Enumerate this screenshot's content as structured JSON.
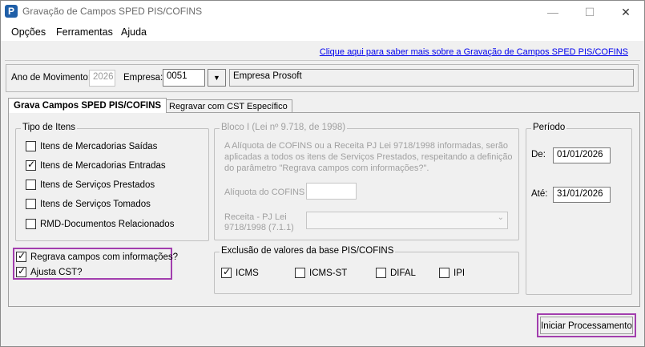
{
  "window": {
    "title": "Gravação de Campos SPED PIS/COFINS"
  },
  "menu": {
    "items": [
      "Opções",
      "Ferramentas",
      "Ajuda"
    ]
  },
  "help_link": "Clique aqui para saber mais sobre a Gravação de Campos SPED PIS/COFINS",
  "header": {
    "ano_label": "Ano de Movimento:",
    "ano_value": "2026",
    "empresa_label": "Empresa:",
    "empresa_code": "0051",
    "empresa_name": "Empresa Prosoft"
  },
  "tabs": [
    {
      "label": "Grava Campos SPED PIS/COFINS",
      "active": true
    },
    {
      "label": "Regravar com CST Específico",
      "active": false
    }
  ],
  "tipo_itens": {
    "legend": "Tipo de Itens",
    "items": [
      {
        "label": "Itens de Mercadorias Saídas",
        "checked": false
      },
      {
        "label": "Itens de Mercadorias Entradas",
        "checked": true
      },
      {
        "label": "Itens de Serviços Prestados",
        "checked": false
      },
      {
        "label": "Itens de Serviços Tomados",
        "checked": false
      },
      {
        "label": "RMD-Documentos Relacionados",
        "checked": false
      }
    ]
  },
  "options": [
    {
      "label": "Regrava campos com informações?",
      "checked": true
    },
    {
      "label": "Ajusta CST?",
      "checked": true
    }
  ],
  "bloco": {
    "legend": "Bloco I (Lei nº 9.718, de 1998)",
    "description": "A Alíquota de COFINS ou a Receita PJ Lei 9718/1998 informadas, serão aplicadas a todos os itens de Serviços Prestados, respeitando a definição do parâmetro \"Regrava campos com informações?\".",
    "aliquota_label": "Alíquota do COFINS",
    "receita_label_1": "Receita - PJ Lei",
    "receita_label_2": "9718/1998 (7.1.1)"
  },
  "exclusao": {
    "legend": "Exclusão de valores da base PIS/COFINS",
    "items": [
      {
        "label": "ICMS",
        "checked": true
      },
      {
        "label": "ICMS-ST",
        "checked": false
      },
      {
        "label": "DIFAL",
        "checked": false
      },
      {
        "label": "IPI",
        "checked": false
      }
    ]
  },
  "periodo": {
    "legend": "Período",
    "de_label": "De:",
    "de_value": "01/01/2026",
    "ate_label": "Até:",
    "ate_value": "31/01/2026"
  },
  "actions": {
    "start_label": "Iniciar Processamento"
  },
  "colors": {
    "highlight": "#a23eae",
    "link": "#0000ee",
    "app_icon": "#1f5fa8"
  }
}
